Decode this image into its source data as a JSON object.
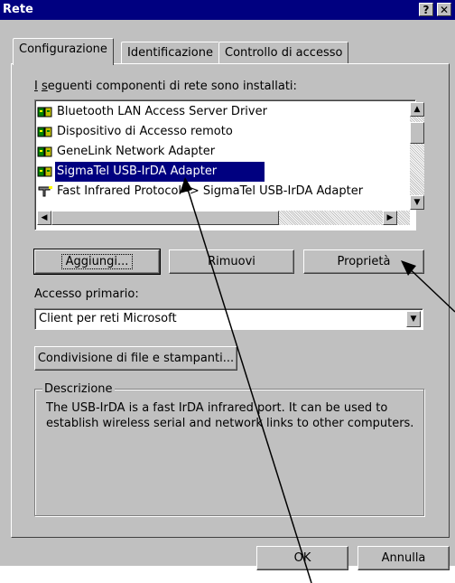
{
  "window": {
    "title": "Rete",
    "help_glyph": "?",
    "close_glyph": "✕"
  },
  "tabs": [
    {
      "label": "Configurazione",
      "active": true
    },
    {
      "label": "Identificazione",
      "active": false
    },
    {
      "label": "Controllo di accesso",
      "active": false
    }
  ],
  "components": {
    "label": "I seguenti componenti di rete sono installati:",
    "items": [
      {
        "label": "Bluetooth LAN Access Server Driver",
        "icon": "network-adapter-icon",
        "selected": false
      },
      {
        "label": "Dispositivo di Accesso remoto",
        "icon": "network-adapter-icon",
        "selected": false
      },
      {
        "label": "GeneLink Network Adapter",
        "icon": "network-adapter-icon",
        "selected": false
      },
      {
        "label": "SigmaTel USB-IrDA Adapter",
        "icon": "network-adapter-icon",
        "selected": true
      },
      {
        "label": "Fast Infrared Protocol -> SigmaTel USB-IrDA Adapter",
        "icon": "network-protocol-icon",
        "selected": false
      }
    ]
  },
  "buttons": {
    "add": "Aggiungi...",
    "remove": "Rimuovi",
    "properties": "Proprietà",
    "sharing": "Condivisione di file e stampanti...",
    "ok": "OK",
    "cancel": "Annulla"
  },
  "primary_access": {
    "label": "Accesso primario:",
    "value": "Client per reti Microsoft"
  },
  "description": {
    "legend": "Descrizione",
    "text": "The USB-IrDA is a fast IrDA infrared port. It can be used to establish wireless serial and network links to other computers."
  },
  "colors": {
    "title_bar": "#000080",
    "selection": "#000080",
    "face": "#c0c0c0"
  }
}
